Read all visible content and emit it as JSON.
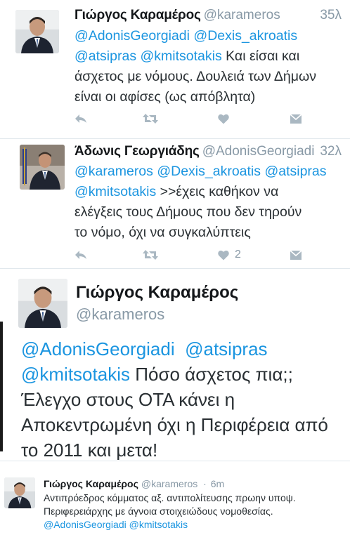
{
  "tweet1": {
    "name": "Γιώργος Καραμέρος",
    "handle": "@karameros",
    "time": "35λ",
    "mentions": [
      "@AdonisGeorgiadi",
      "@Dexis_akroatis",
      "@atsipras",
      "@kmitsotakis"
    ],
    "text_line2_rest": "Και είσαι και",
    "text_line3": "άσχετος με νόμους. Δουλειά των Δήμων",
    "text_line4": "είναι οι αφίσες (ως απόβλητα)",
    "like_count": ""
  },
  "tweet2": {
    "name": "Άδωνις Γεωργιάδης",
    "handle": "@AdonisGeorgiadi",
    "time": "32λ",
    "mentions": [
      "@karameros",
      "@Dexis_akroatis",
      "@atsipras",
      "@kmitsotakis"
    ],
    "text_line2_rest": ">>έχεις καθήκον να",
    "text_line3": "ελέγξεις τους Δήμους που δεν τηρούν",
    "text_line4": "το νόμο, όχι να συγκαλύπτεις",
    "like_count": "2"
  },
  "tweet3": {
    "name": "Γιώργος Καραμέρος",
    "handle": "@karameros",
    "mentions": [
      "@AdonisGeorgiadi",
      "@atsipras",
      "@kmitsotakis"
    ],
    "text_line2_rest": "Πόσο άσχετος πια;;",
    "text_line3": "Έλεγχο στους ΟΤΑ κάνει η",
    "text_line4": "Αποκεντρωμένη όχι η Περιφέρεια από",
    "text_line5": "το 2011 και μετα!"
  },
  "tweet4": {
    "name": "Γιώργος Καραμέρος",
    "handle": "@karameros",
    "dot": "·",
    "time": "6m",
    "text_line1": "Αντιπρόεδρος κόμματος αξ. αντιπολίτευσης πρωην υποψ.",
    "text_line2": "Περιφερειάρχης με άγνοια στοιχειώδους νομοθεσίας.",
    "mentions": [
      "@AdonisGeorgiadi",
      "@kmitsotakis"
    ]
  },
  "icons": {
    "reply": "reply-icon",
    "retweet": "retweet-icon",
    "like": "heart-icon",
    "message": "envelope-icon"
  },
  "colors": {
    "mention": "#1b95e0",
    "muted": "#8899a6",
    "icon": "#aab8c2"
  }
}
